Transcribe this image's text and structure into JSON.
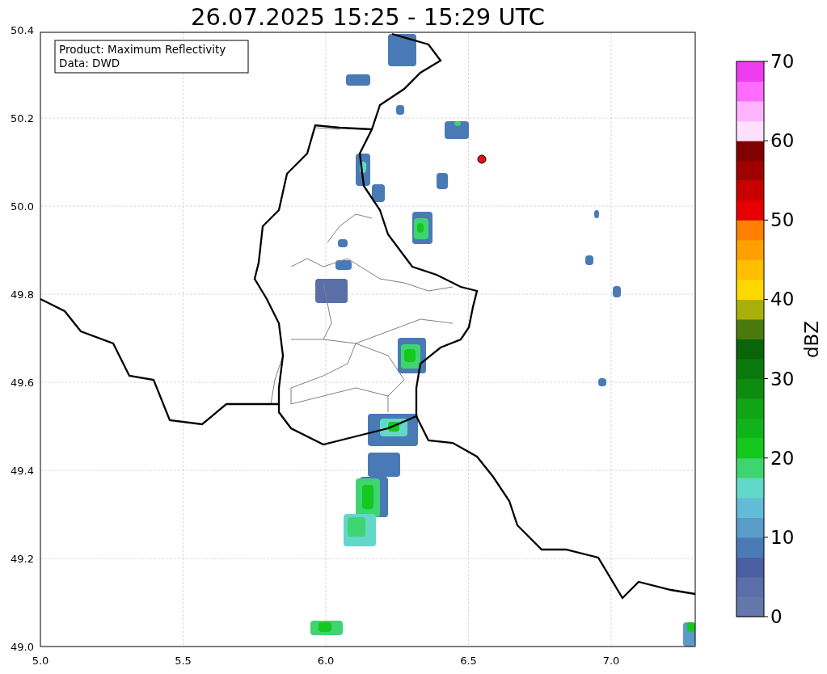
{
  "title": "26.07.2025 15:25 - 15:29 UTC",
  "info_box": {
    "lines": [
      "Product: Maximum Reflectivity",
      "Data: DWD"
    ]
  },
  "map": {
    "xticks": [
      "5.0",
      "5.5",
      "6.0",
      "6.5",
      "7.0"
    ],
    "yticks": [
      "50.4",
      "50.2",
      "50.0",
      "49.8",
      "49.6",
      "49.4",
      "49.2",
      "49.0"
    ]
  },
  "colorbar": {
    "label": "dBZ",
    "ticks": [
      "70",
      "60",
      "50",
      "40",
      "30",
      "20",
      "10",
      "0"
    ],
    "segments": [
      {
        "color": "#6577a8"
      },
      {
        "color": "#5a6ea8"
      },
      {
        "color": "#4a5fa2"
      },
      {
        "color": "#4a7ab5"
      },
      {
        "color": "#5a9cc8"
      },
      {
        "color": "#62bcd8"
      },
      {
        "color": "#62d8c8"
      },
      {
        "color": "#3ed470"
      },
      {
        "color": "#14c81e"
      },
      {
        "color": "#10b41a"
      },
      {
        "color": "#0fa514"
      },
      {
        "color": "#0e8c10"
      },
      {
        "color": "#0a7a0c"
      },
      {
        "color": "#0a640a"
      },
      {
        "color": "#4a7a0c"
      },
      {
        "color": "#aab00a"
      },
      {
        "color": "#ffd800"
      },
      {
        "color": "#ffbe00"
      },
      {
        "color": "#ffa000"
      },
      {
        "color": "#ff8000"
      },
      {
        "color": "#e60000"
      },
      {
        "color": "#c80000"
      },
      {
        "color": "#a00000"
      },
      {
        "color": "#800000"
      },
      {
        "color": "#ffe0ff"
      },
      {
        "color": "#ffb4ff"
      },
      {
        "color": "#ff6cff"
      },
      {
        "color": "#ee3cee"
      }
    ]
  }
}
